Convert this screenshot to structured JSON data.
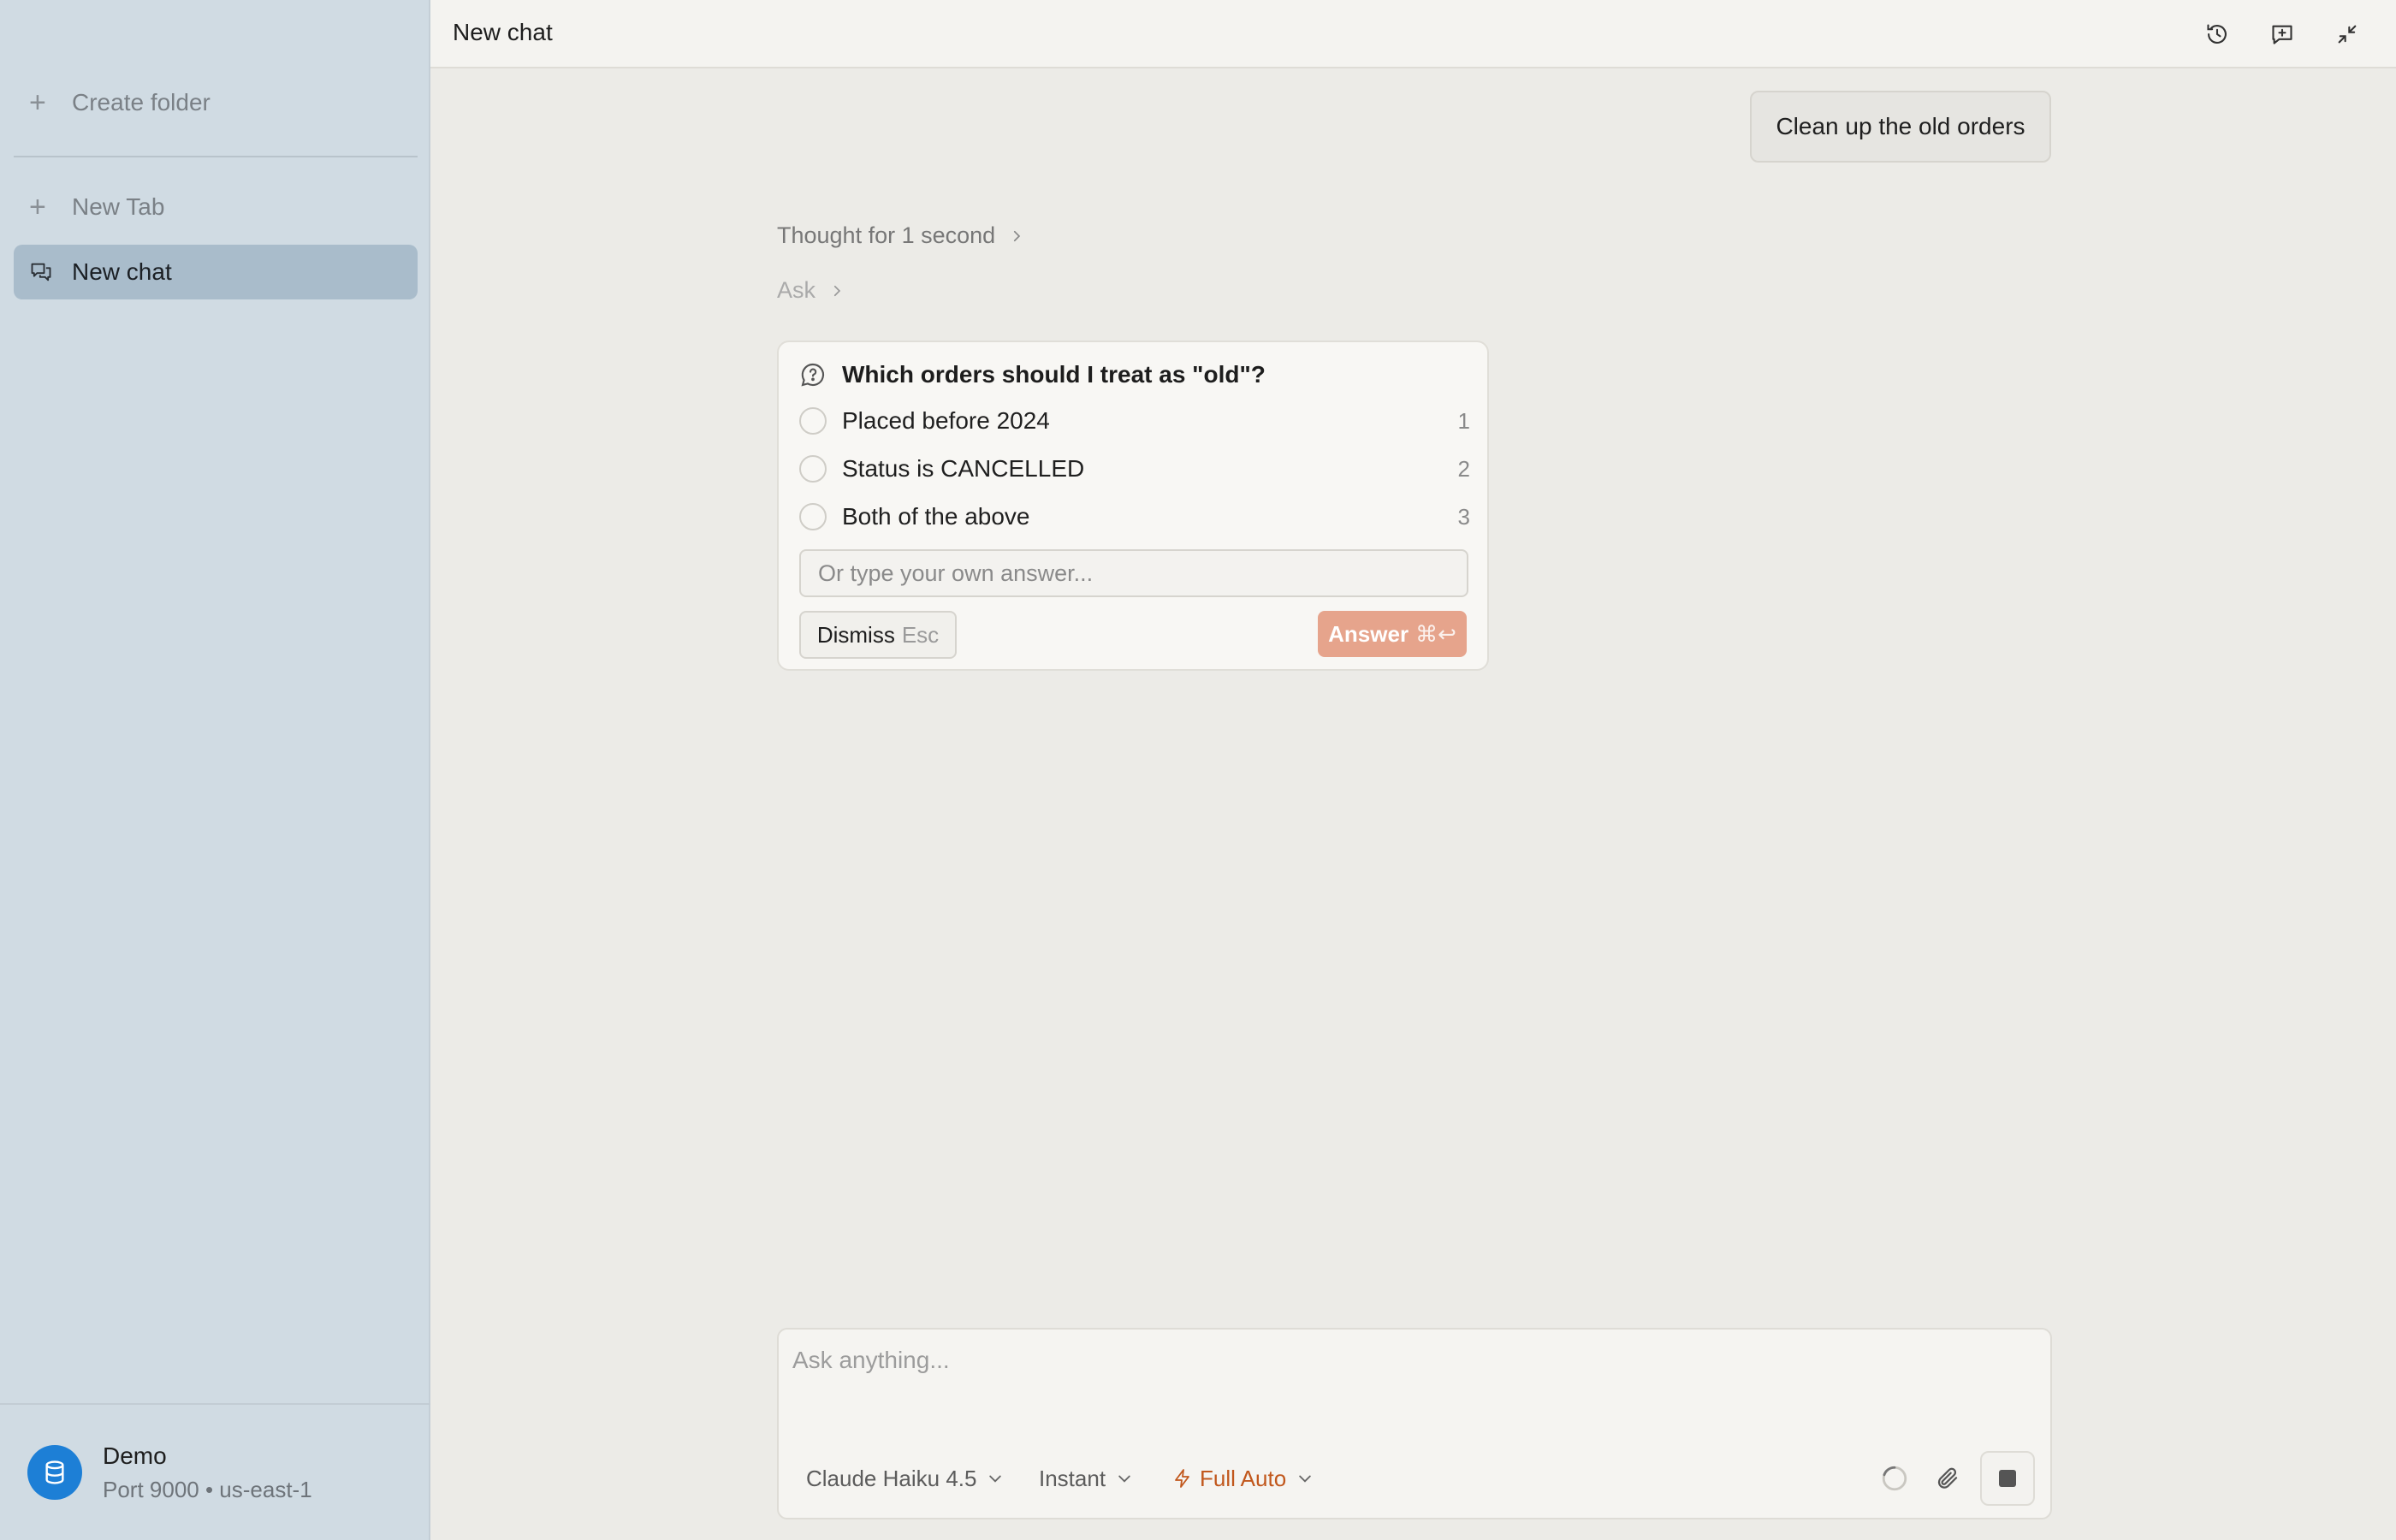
{
  "sidebar": {
    "create_folder": "Create folder",
    "new_tab": "New Tab",
    "active_chat": "New chat",
    "connection": {
      "name": "Demo",
      "detail": "Port 9000 • us-east-1"
    }
  },
  "header": {
    "title": "New chat",
    "icons": [
      "history-icon",
      "new-chat-icon",
      "collapse-icon"
    ]
  },
  "conversation": {
    "user_message": "Clean up the old orders",
    "thought_label": "Thought for 1 second",
    "ask_label": "Ask"
  },
  "question_card": {
    "question": "Which orders should I treat as \"old\"?",
    "options": [
      {
        "label": "Placed before 2024",
        "shortcut": "1"
      },
      {
        "label": "Status is CANCELLED",
        "shortcut": "2"
      },
      {
        "label": "Both of the above",
        "shortcut": "3"
      }
    ],
    "own_answer_placeholder": "Or type your own answer...",
    "dismiss_label": "Dismiss",
    "dismiss_shortcut": "Esc",
    "answer_label": "Answer",
    "answer_shortcut": "⌘↩"
  },
  "composer": {
    "placeholder": "Ask anything...",
    "model": "Claude Haiku 4.5",
    "speed": "Instant",
    "mode": "Full Auto"
  },
  "colors": {
    "accent": "#c1571c",
    "answer_button": "#e6a48c",
    "sidebar_bg": "#d0dbe3",
    "sidebar_active": "#a9bccb",
    "db_avatar": "#1d7fd6"
  }
}
